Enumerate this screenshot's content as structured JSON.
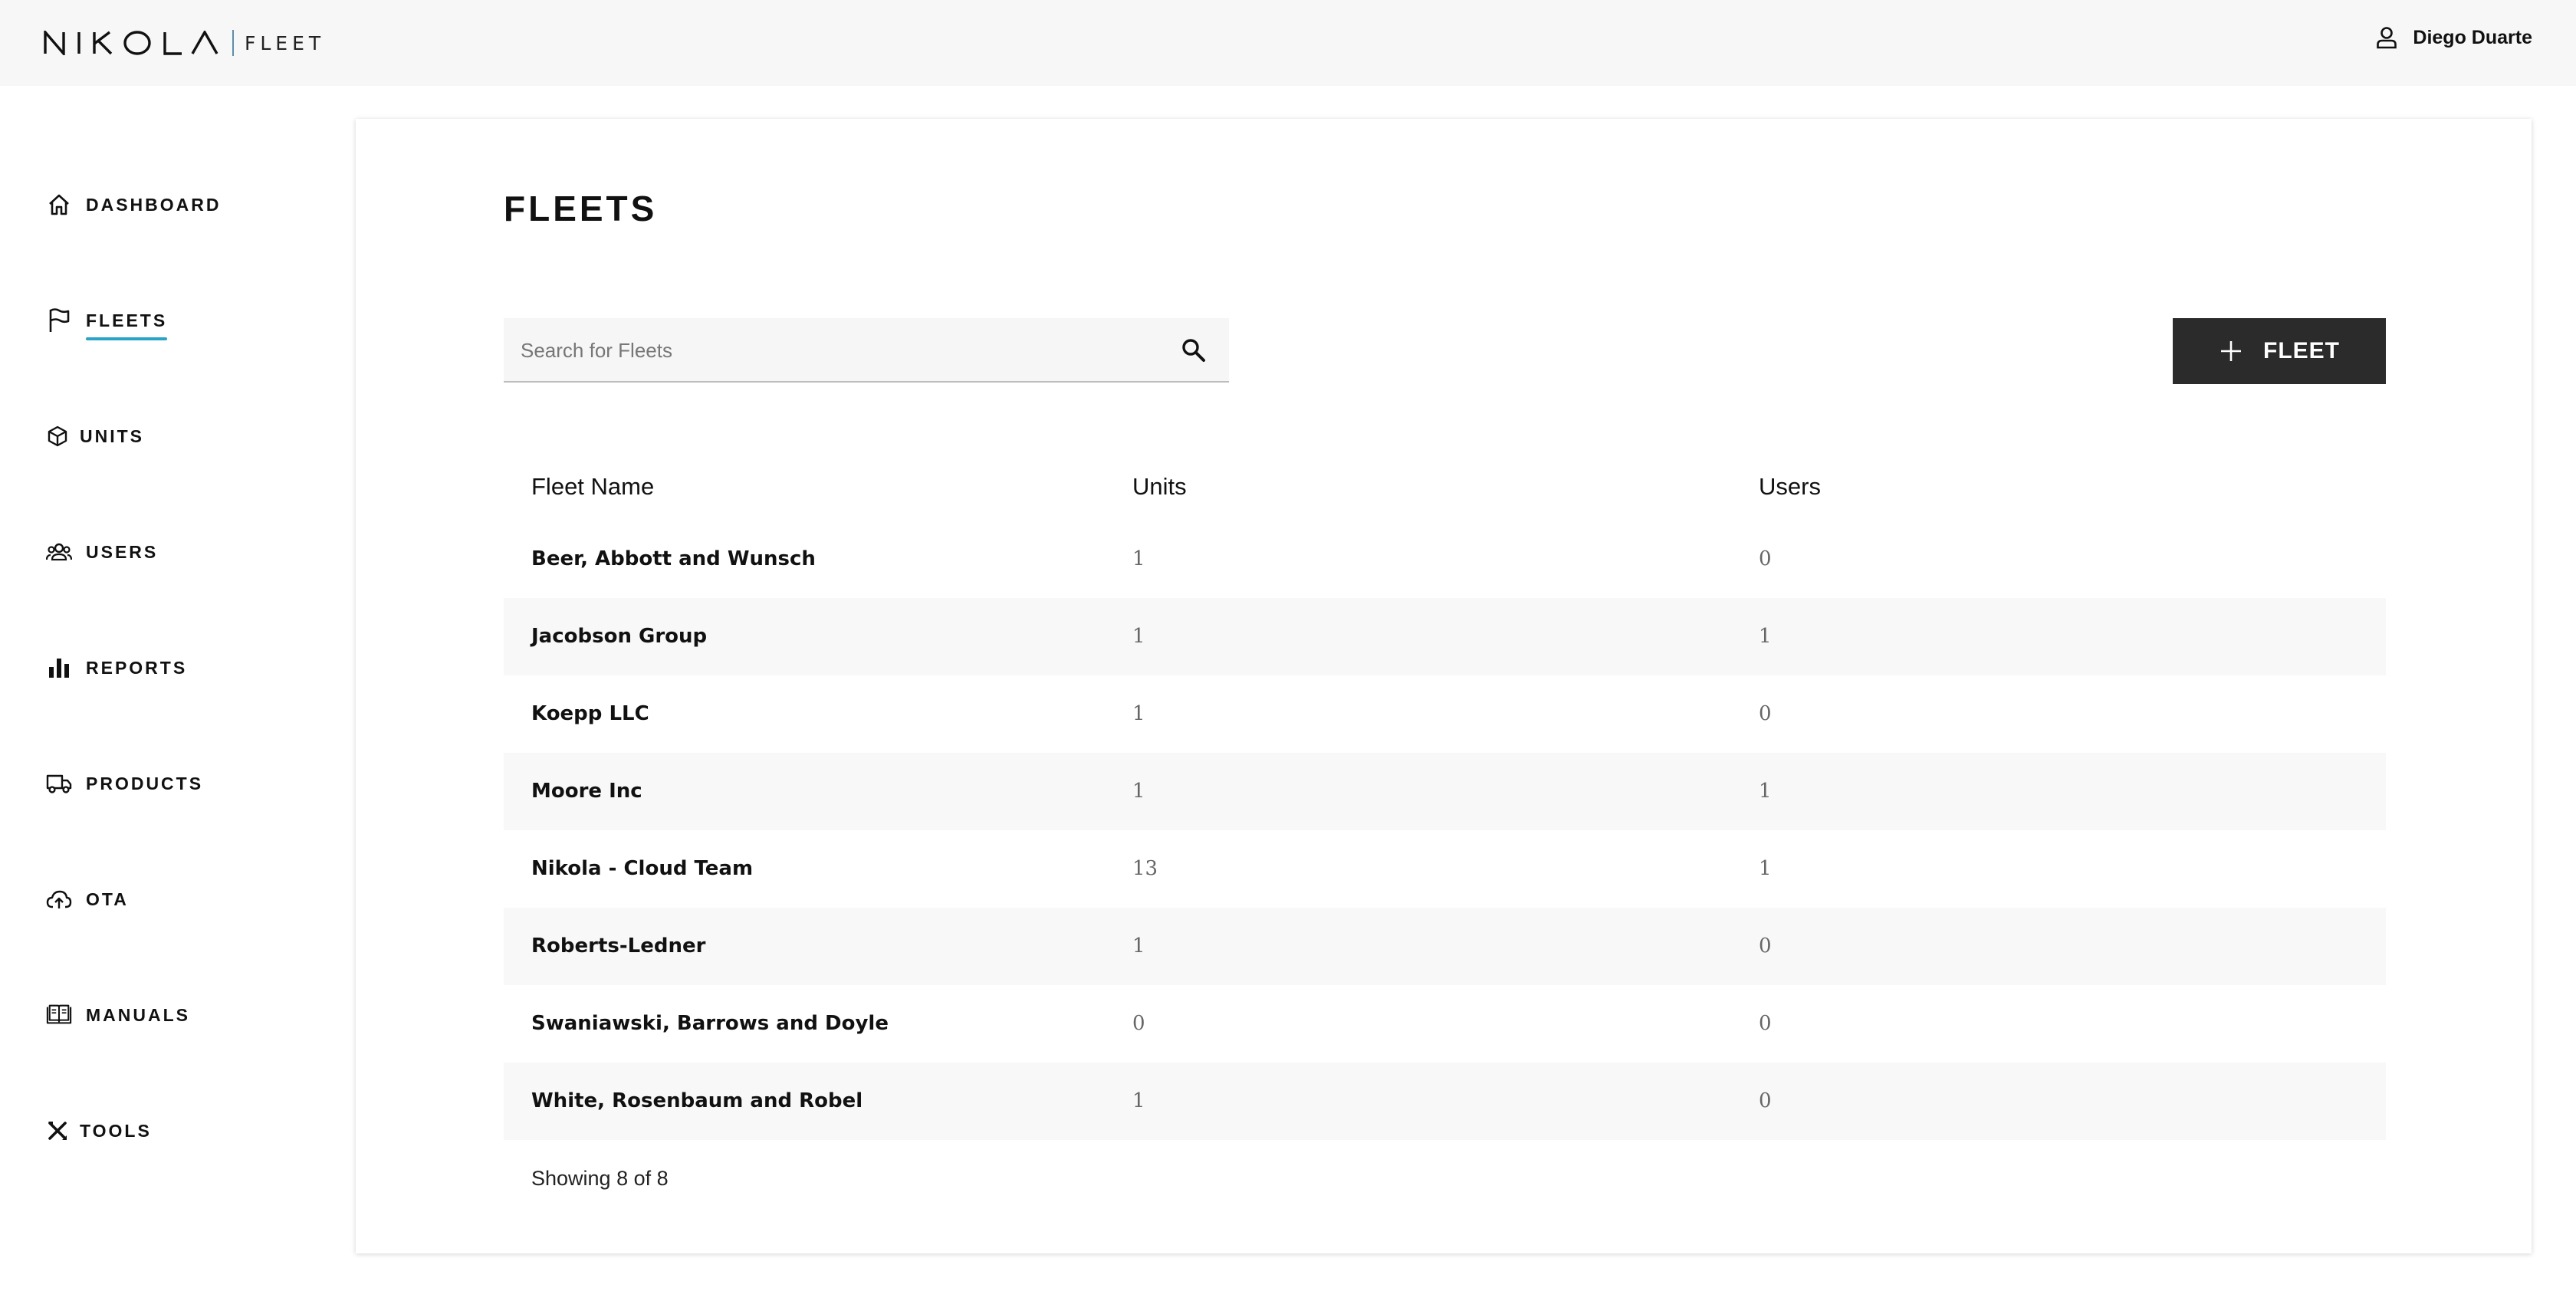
{
  "header": {
    "logo_sub": "FLEET",
    "user_name": "Diego Duarte"
  },
  "sidebar": {
    "items": [
      {
        "label": "DASHBOARD",
        "icon": "home-icon",
        "active": false
      },
      {
        "label": "FLEETS",
        "icon": "flag-icon",
        "active": true
      },
      {
        "label": "UNITS",
        "icon": "cube-icon",
        "active": false
      },
      {
        "label": "USERS",
        "icon": "users-icon",
        "active": false
      },
      {
        "label": "REPORTS",
        "icon": "bar-chart-icon",
        "active": false
      },
      {
        "label": "PRODUCTS",
        "icon": "truck-icon",
        "active": false
      },
      {
        "label": "OTA",
        "icon": "cloud-upload-icon",
        "active": false
      },
      {
        "label": "MANUALS",
        "icon": "book-icon",
        "active": false
      },
      {
        "label": "TOOLS",
        "icon": "tools-icon",
        "active": false
      }
    ],
    "accent_color": "#2aa3c8"
  },
  "main": {
    "title": "FLEETS",
    "search": {
      "placeholder": "Search for Fleets",
      "value": ""
    },
    "add_button_label": "FLEET",
    "table": {
      "columns": [
        "Fleet Name",
        "Units",
        "Users"
      ],
      "rows": [
        {
          "name": "Beer, Abbott and Wunsch",
          "units": "1",
          "users": "0"
        },
        {
          "name": "Jacobson Group",
          "units": "1",
          "users": "1"
        },
        {
          "name": "Koepp LLC",
          "units": "1",
          "users": "0"
        },
        {
          "name": "Moore Inc",
          "units": "1",
          "users": "1"
        },
        {
          "name": "Nikola - Cloud Team",
          "units": "13",
          "users": "1"
        },
        {
          "name": "Roberts-Ledner",
          "units": "1",
          "users": "0"
        },
        {
          "name": "Swaniawski, Barrows and Doyle",
          "units": "0",
          "users": "0"
        },
        {
          "name": "White, Rosenbaum and Robel",
          "units": "1",
          "users": "0"
        }
      ],
      "footer": "Showing 8 of 8"
    }
  }
}
